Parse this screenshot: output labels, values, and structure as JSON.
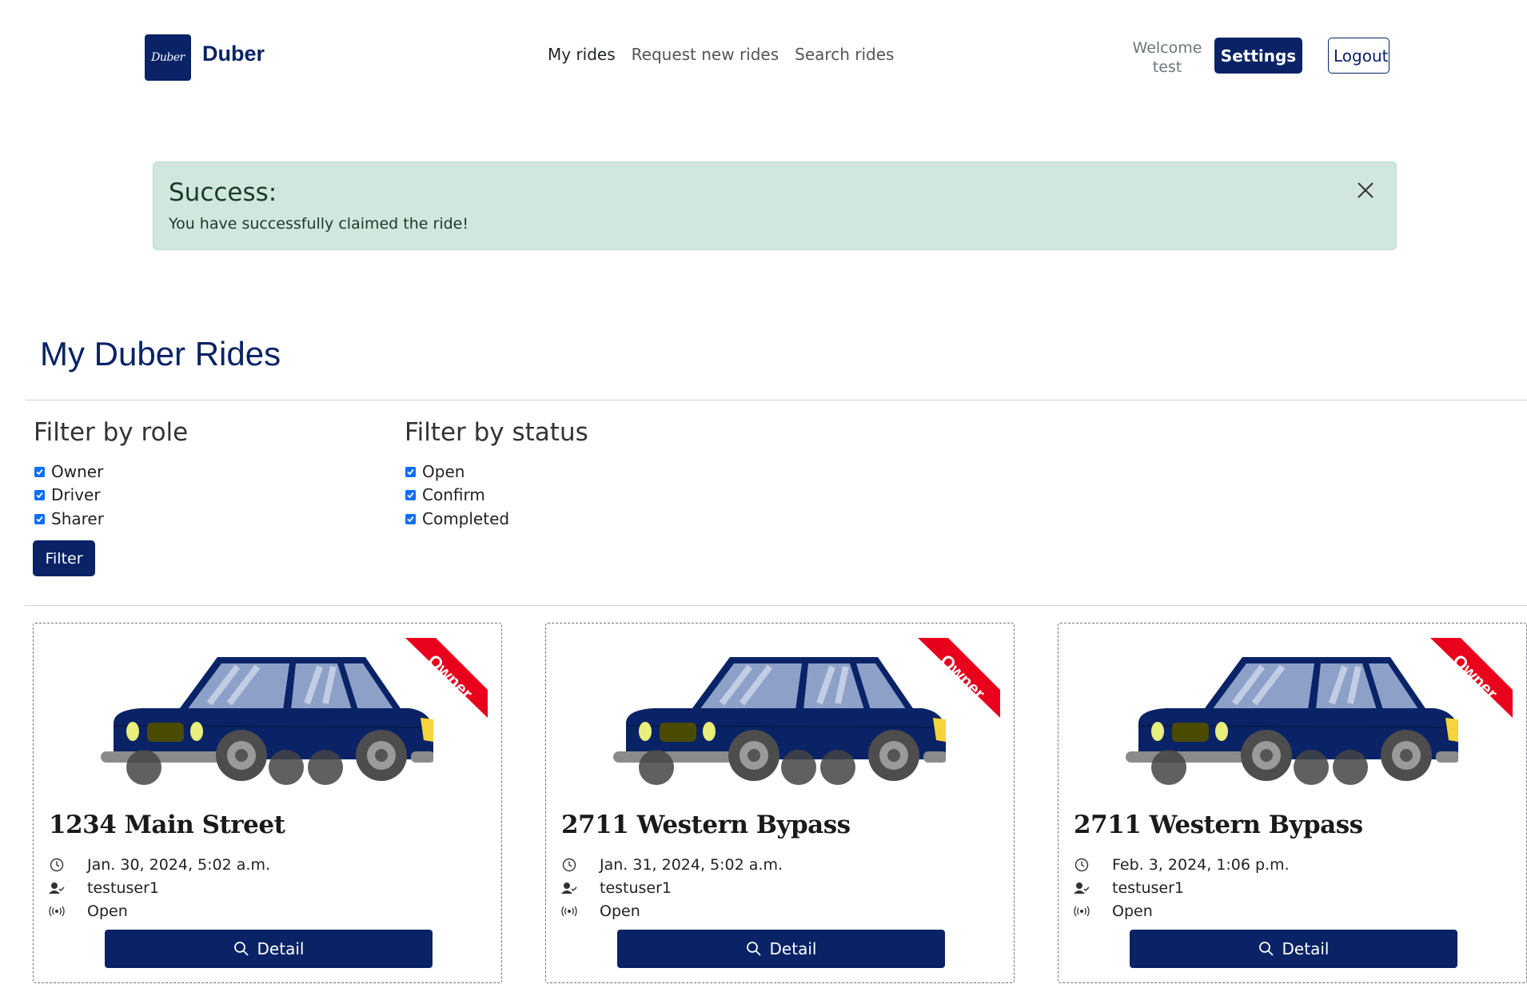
{
  "header": {
    "logo_text": "Duber",
    "brand": "Duber",
    "nav": [
      "My rides",
      "Request new rides",
      "Search rides"
    ],
    "welcome_label": "Welcome",
    "username": "test",
    "settings_label": "Settings",
    "logout_label": "Logout"
  },
  "alert": {
    "title": "Success:",
    "message": "You have successfully claimed the ride!"
  },
  "page_title": "My Duber Rides",
  "filters": {
    "role": {
      "title": "Filter by role",
      "options": [
        {
          "label": "Owner",
          "checked": true
        },
        {
          "label": "Driver",
          "checked": true
        },
        {
          "label": "Sharer",
          "checked": true
        }
      ]
    },
    "status": {
      "title": "Filter by status",
      "options": [
        {
          "label": "Open",
          "checked": true
        },
        {
          "label": "Confirm",
          "checked": true
        },
        {
          "label": "Completed",
          "checked": true
        }
      ]
    },
    "button_label": "Filter"
  },
  "rides": [
    {
      "destination": "1234 Main Street",
      "time": "Jan. 30, 2024, 5:02 a.m.",
      "owner": "testuser1",
      "status": "Open",
      "role_ribbon": "Owner",
      "detail_label": "Detail"
    },
    {
      "destination": "2711 Western Bypass",
      "time": "Jan. 31, 2024, 5:02 a.m.",
      "owner": "testuser1",
      "status": "Open",
      "role_ribbon": "Owner",
      "detail_label": "Detail"
    },
    {
      "destination": "2711 Western Bypass",
      "time": "Feb. 3, 2024, 1:06 p.m.",
      "owner": "testuser1",
      "status": "Open",
      "role_ribbon": "Owner",
      "detail_label": "Detail"
    }
  ],
  "colors": {
    "primary": "#0a2366",
    "alert_bg": "#d1e7dd",
    "ribbon": "#e8001c",
    "car_body": "#0a2366"
  },
  "icons": {
    "time": "clock-icon",
    "owner": "user-check-icon",
    "status": "broadcast-icon",
    "detail": "search-icon",
    "close": "close-icon"
  }
}
